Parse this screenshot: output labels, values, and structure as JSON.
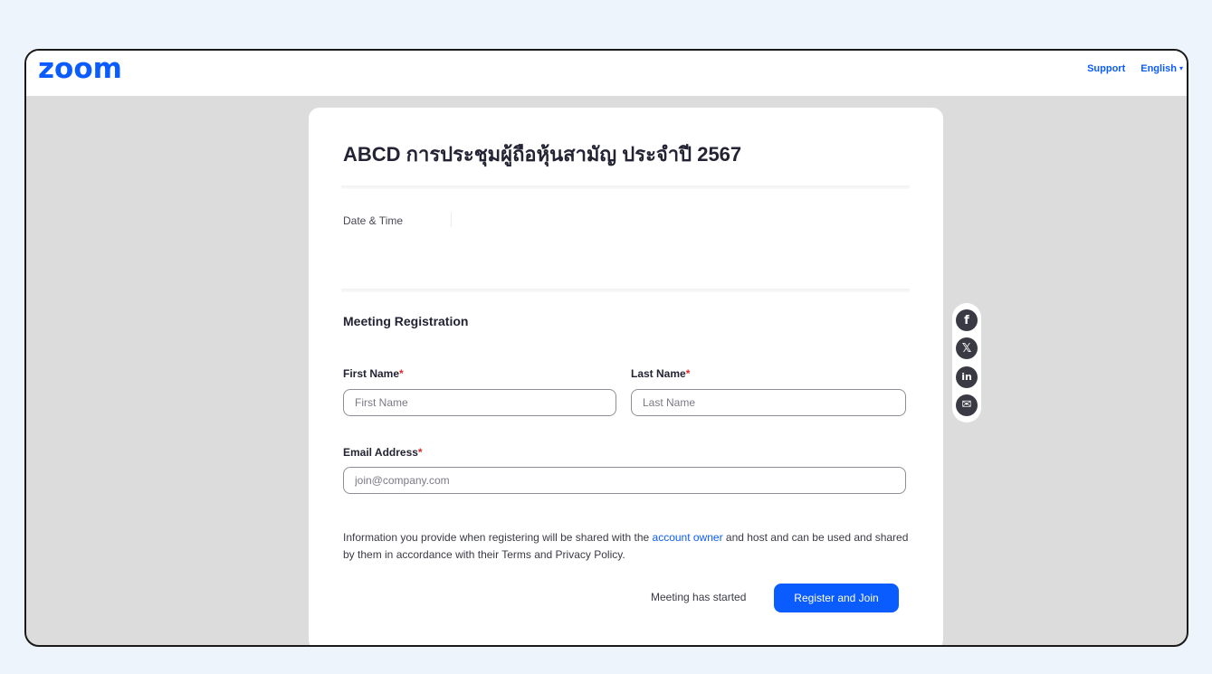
{
  "header": {
    "logo": "zoom",
    "support_label": "Support",
    "language_label": "English",
    "language_caret": "▾"
  },
  "card": {
    "title": "ABCD การประชุมผู้ถือหุ้นสามัญ ประจำปี 2567",
    "date_time_label": "Date & Time",
    "section_title": "Meeting Registration",
    "first_name": {
      "label": "First Name",
      "required_mark": "*",
      "placeholder": "First Name",
      "value": ""
    },
    "last_name": {
      "label": "Last Name",
      "required_mark": "*",
      "placeholder": "Last Name",
      "value": ""
    },
    "email": {
      "label": "Email Address",
      "required_mark": "*",
      "placeholder": "join@company.com",
      "value": ""
    },
    "info_text_before": "Information you provide when registering will be shared with the ",
    "info_link": "account owner",
    "info_text_after": " and host and can be used and shared by them in accordance with their Terms and Privacy Policy.",
    "status_text": "Meeting has started",
    "submit_label": "Register and Join"
  },
  "social": {
    "facebook_glyph": "f",
    "x_glyph": "𝕏",
    "linkedin_glyph": "in",
    "email_glyph": "✉"
  },
  "colors": {
    "brand": "#0b5cff",
    "required": "#e02828",
    "backdrop": "#dcdcdc",
    "page": "#eef4fb"
  }
}
